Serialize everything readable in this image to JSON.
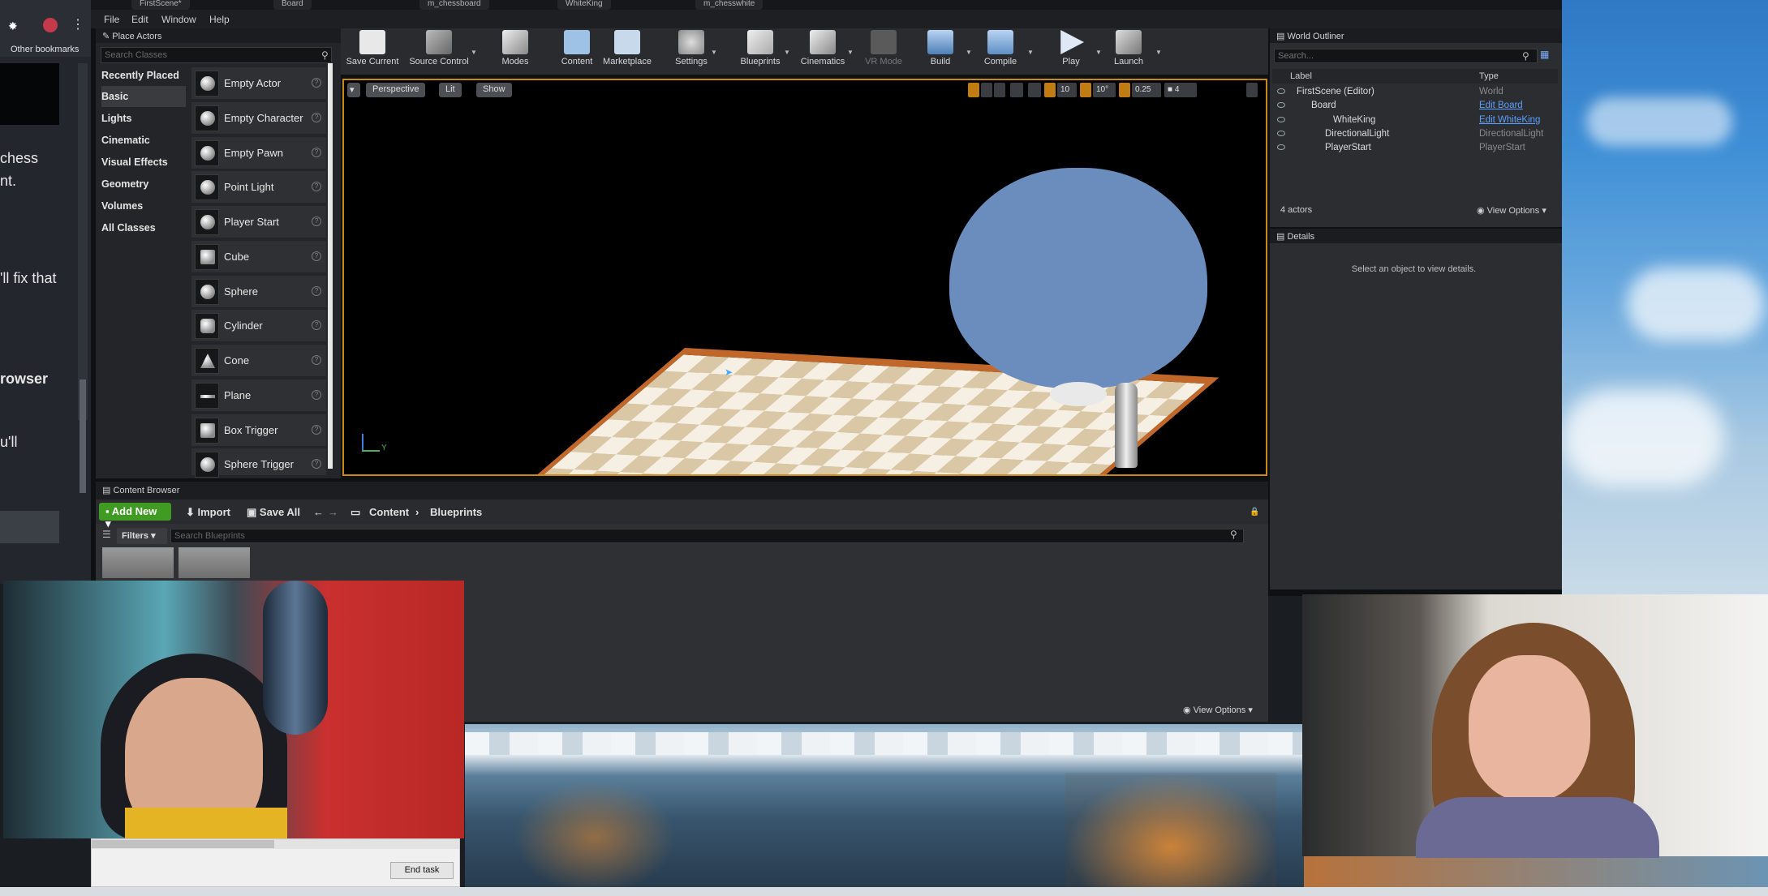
{
  "browser": {
    "bookmarks_label": "Other bookmarks",
    "tabs": [
      "FirstScene*",
      "Board",
      "m_chessboard",
      "WhiteKing",
      "m_chesswhite"
    ],
    "left_text": [
      "chess",
      "nt.",
      "",
      "'ll fix that",
      "",
      "rowser",
      "",
      "u'll"
    ]
  },
  "menu": [
    "File",
    "Edit",
    "Window",
    "Help"
  ],
  "place_actors": {
    "title": "Place Actors",
    "search_placeholder": "Search Classes",
    "categories": [
      "Recently Placed",
      "Basic",
      "Lights",
      "Cinematic",
      "Visual Effects",
      "Geometry",
      "Volumes",
      "All Classes"
    ],
    "selected_category": "Basic",
    "actors": [
      "Empty Actor",
      "Empty Character",
      "Empty Pawn",
      "Point Light",
      "Player Start",
      "Cube",
      "Sphere",
      "Cylinder",
      "Cone",
      "Plane",
      "Box Trigger",
      "Sphere Trigger"
    ]
  },
  "toolbar": {
    "items": [
      "Save Current",
      "Source Control",
      "Modes",
      "Content",
      "Marketplace",
      "Settings",
      "Blueprints",
      "Cinematics",
      "VR Mode",
      "Build",
      "Compile",
      "Play",
      "Launch"
    ]
  },
  "viewport": {
    "perspective": "Perspective",
    "lit": "Lit",
    "show": "Show",
    "grid_snap": "10",
    "rot_snap": "10°",
    "scale_snap": "0.25",
    "cam_speed": "4",
    "axis_label": "Y"
  },
  "content_browser": {
    "title": "Content Browser",
    "add_new": "Add New",
    "import": "Import",
    "save_all": "Save All",
    "path": [
      "Content",
      "Blueprints"
    ],
    "filters": "Filters",
    "search_placeholder": "Search Blueprints",
    "view_options": "View Options"
  },
  "outliner": {
    "title": "World Outliner",
    "search_placeholder": "Search...",
    "col_label": "Label",
    "col_type": "Type",
    "rows": [
      {
        "label": "FirstScene (Editor)",
        "type": "World"
      },
      {
        "label": "Board",
        "type": "Edit Board"
      },
      {
        "label": "WhiteKing",
        "type": "Edit WhiteKing"
      },
      {
        "label": "DirectionalLight",
        "type": "DirectionalLight"
      },
      {
        "label": "PlayerStart",
        "type": "PlayerStart"
      }
    ],
    "count": "4 actors",
    "view_options": "View Options"
  },
  "details": {
    "title": "Details",
    "message": "Select an object to view details."
  },
  "taskmanager": {
    "end_task": "End task"
  },
  "colors": {
    "accent": "#c78a19",
    "add_new": "#3f9b22",
    "link": "#5aa0ff",
    "sphere": "#6b8dbd"
  }
}
